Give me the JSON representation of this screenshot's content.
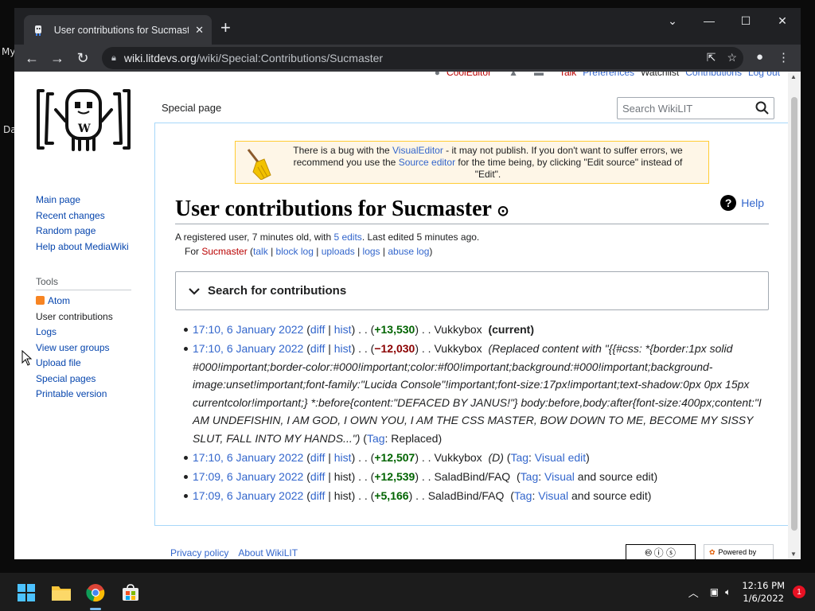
{
  "desktop": {
    "label_top": "My",
    "label_mid": "Da"
  },
  "browser": {
    "tab_title": "User contributions for Sucmaster",
    "new_tab": "+",
    "url_domain": "wiki.litdevs.org",
    "url_path": "/wiki/Special:Contributions/Sucmaster"
  },
  "usertools": {
    "username": "CoolEditor",
    "talk": "Talk",
    "preferences": "Preferences",
    "watchlist": "Watchlist",
    "contributions": "Contributions",
    "logout": "Log out"
  },
  "sidebar": {
    "nav": [
      "Main page",
      "Recent changes",
      "Random page",
      "Help about MediaWiki"
    ],
    "tools_heading": "Tools",
    "tools": [
      "Atom",
      "User contributions",
      "Logs",
      "View user groups",
      "Upload file",
      "Special pages",
      "Printable version"
    ]
  },
  "page": {
    "tab": "Special page",
    "search_placeholder": "Search WikiLIT",
    "banner": {
      "t1": "There is a bug with the ",
      "link1": "VisualEditor",
      "t2": " - it may not publish. If you don't want to suffer errors, we recommend you use the ",
      "link2": "Source editor",
      "t3": " for the time being, by clicking \"Edit source\" instead of \"Edit\"."
    },
    "title": "User contributions for Sucmaster",
    "help": "Help",
    "registered": "A registered user, ",
    "age": "7 minutes old",
    "with": ", with ",
    "edits": "5 edits",
    "last_edited": ". Last edited ",
    "last_edit_time": "5 minutes ago",
    "period": ".",
    "for": "For ",
    "user": "Sucmaster",
    "links": {
      "talk": "talk",
      "block_log": "block log",
      "uploads": "uploads",
      "logs": "logs",
      "abuse_log": "abuse log"
    },
    "search_contribs": "Search for contributions"
  },
  "contribs": [
    {
      "time": "17:10, 6 January 2022",
      "diff": "diff",
      "hist": "hist",
      "size": "+13,530",
      "page": "Vukkybox",
      "extra": "(current)"
    },
    {
      "time": "17:10, 6 January 2022",
      "diff": "diff",
      "hist": "hist",
      "size": "−12,030",
      "page": "Vukkybox",
      "comment": "(Replaced content with \"{{#css: *{border:1px solid #000!important;border-color:#000!important;color:#f00!important;background:#000!important;background-image:unset!important;font-family:\"Lucida Console\"!important;font-size:17px!important;text-shadow:0px 0px 15px currentcolor!important;} *:before{content:\"DEFACED BY JANUS!\"} body:before,body:after{font-size:400px;content:\"I AM UNDEFISHIN, I AM GOD, I OWN YOU, I AM THE CSS MASTER, BOW DOWN TO ME, BECOME MY SISSY SLUT, FALL INTO MY HANDS...\")",
      "tag_label": "Tag",
      "tag": "Replaced"
    },
    {
      "time": "17:10, 6 January 2022",
      "diff": "diff",
      "hist": "hist",
      "size": "+12,507",
      "page": "Vukkybox",
      "flag": "(D)",
      "tag_label": "Tag",
      "tag": "Visual edit"
    },
    {
      "time": "17:09, 6 January 2022",
      "diff": "diff",
      "hist": "hist",
      "size": "+12,539",
      "page": "SaladBind/FAQ",
      "tag_label": "Tag",
      "tag_link": "Visual",
      "tag_rest": "and source edit"
    },
    {
      "time": "17:09, 6 January 2022",
      "diff": "diff",
      "hist": "hist",
      "size": "+5,166",
      "page": "SaladBind/FAQ",
      "tag_label": "Tag",
      "tag_link": "Visual",
      "tag_rest": "and source edit"
    }
  ],
  "footer": {
    "privacy": "Privacy policy",
    "about": "About WikiLIT",
    "powered": "Powered by"
  },
  "taskbar": {
    "time": "12:16 PM",
    "date": "1/6/2022",
    "notif_count": "1"
  }
}
